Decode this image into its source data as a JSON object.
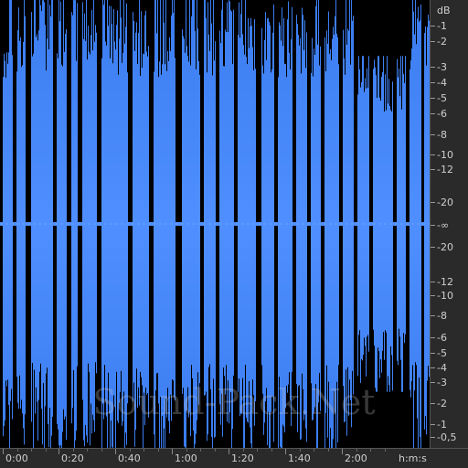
{
  "watermark": "Sound-Pack.Net",
  "colors": {
    "wave": "#3c7ff0",
    "wave_light": "#5a97ff",
    "background": "#000000",
    "ruler": "#2a2a2a"
  },
  "db_scale": [
    {
      "label": "dB",
      "level": 0.0
    },
    {
      "label": "-1",
      "level": 0.891
    },
    {
      "label": "-2",
      "level": 0.794
    },
    {
      "label": "-3",
      "level": 0.708
    },
    {
      "label": "-4",
      "level": 0.631
    },
    {
      "label": "-5",
      "level": 0.562
    },
    {
      "label": "-6",
      "level": 0.501
    },
    {
      "label": "-8",
      "level": 0.398
    },
    {
      "label": "-10",
      "level": 0.316
    },
    {
      "label": "-12",
      "level": 0.251
    },
    {
      "label": "-20",
      "level": 0.1
    },
    {
      "label": "-∞",
      "level": 0.0
    },
    {
      "label": "-20",
      "level": -0.1
    },
    {
      "label": "-12",
      "level": -0.251
    },
    {
      "label": "-10",
      "level": -0.316
    },
    {
      "label": "-8",
      "level": -0.398
    },
    {
      "label": "-6",
      "level": -0.501
    },
    {
      "label": "-5",
      "level": -0.562
    },
    {
      "label": "-4",
      "level": -0.631
    },
    {
      "label": "-3",
      "level": -0.708
    },
    {
      "label": "-2",
      "level": -0.794
    },
    {
      "label": "-1",
      "level": -0.891
    },
    {
      "label": "-0,5",
      "level": -0.944
    }
  ],
  "time_scale": {
    "labels": [
      "0:00",
      "0:20",
      "0:40",
      "1:00",
      "1:20",
      "1:40",
      "2:00"
    ],
    "unit": "h:m:s"
  }
}
